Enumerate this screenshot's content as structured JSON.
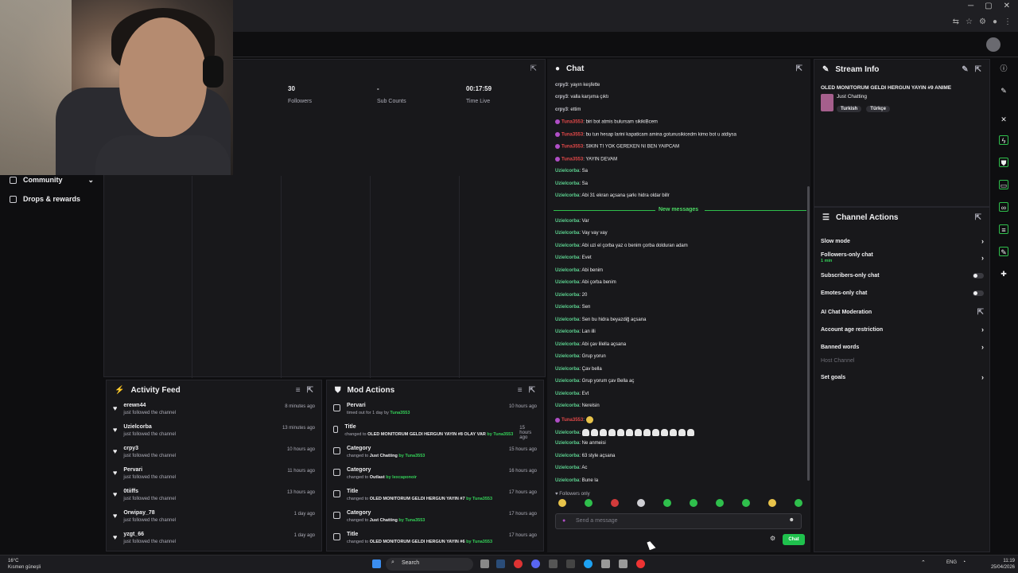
{
  "stats": [
    {
      "value": "30",
      "label": "Followers"
    },
    {
      "value": "-",
      "label": "Sub Counts"
    },
    {
      "value": "00:17:59",
      "label": "Time Live"
    }
  ],
  "nav": {
    "community": "Community",
    "drops": "Drops & rewards"
  },
  "activity": {
    "title": "Activity Feed",
    "items": [
      {
        "name": "erewn44",
        "sub": "just followed the channel",
        "time": "8 minutes ago"
      },
      {
        "name": "Uzielcorba",
        "sub": "just followed the channel",
        "time": "13 minutes ago"
      },
      {
        "name": "crpy3",
        "sub": "just followed the channel",
        "time": "10 hours ago"
      },
      {
        "name": "Pervari",
        "sub": "just followed the channel",
        "time": "11 hours ago"
      },
      {
        "name": "0tiiffs",
        "sub": "just followed the channel",
        "time": "13 hours ago"
      },
      {
        "name": "Orwipay_78",
        "sub": "just followed the channel",
        "time": "1 day ago"
      },
      {
        "name": "yzgt_66",
        "sub": "just followed the channel",
        "time": "1 day ago"
      }
    ]
  },
  "mod": {
    "title": "Mod Actions",
    "items": [
      {
        "title": "Pervari",
        "sub_a": "timed out for 1 day by ",
        "value": "",
        "sub_b": "Tuna3553",
        "time": "10 hours ago"
      },
      {
        "title": "Title",
        "sub_a": "changed to ",
        "value": "OLED MONITORUM GELDI HERGUN YAYIN #8 OLAY VAR",
        "sub_b": "by Tuna3553",
        "time": "15 hours ago"
      },
      {
        "title": "Category",
        "sub_a": "changed to ",
        "value": "Just Chatting",
        "sub_b": "by Tuna3553",
        "time": "15 hours ago"
      },
      {
        "title": "Category",
        "sub_a": "changed to ",
        "value": "Outlast",
        "sub_b": "by lexcaponoir",
        "time": "16 hours ago"
      },
      {
        "title": "Title",
        "sub_a": "changed to ",
        "value": "OLED MONITORUM GELDI HERGUN YAYIN #7",
        "sub_b": "by Tuna3553",
        "time": "17 hours ago"
      },
      {
        "title": "Category",
        "sub_a": "changed to ",
        "value": "Just Chatting",
        "sub_b": "by Tuna3553",
        "time": "17 hours ago"
      },
      {
        "title": "Title",
        "sub_a": "changed to ",
        "value": "OLED MONITORUM GELDI HERGUN YAYIN #6",
        "sub_b": "by Tuna3553",
        "time": "17 hours ago"
      }
    ]
  },
  "chat": {
    "title": "Chat",
    "new_messages": "New messages",
    "followers_only": "Followers only",
    "placeholder": "Send a message",
    "send_label": "Chat",
    "messages": [
      {
        "user": "crpy3",
        "text": ": yayın keşfette",
        "color": "gray",
        "badge": false
      },
      {
        "user": "crpy3",
        "text": ": valla karşıma çıktı",
        "color": "gray",
        "badge": false
      },
      {
        "user": "crpy3",
        "text": ": ettim",
        "color": "gray",
        "badge": false
      },
      {
        "user": "Tuna3553",
        "text": ": biri bot atmis bulursam sikikiBcem",
        "color": "red",
        "badge": true
      },
      {
        "user": "Tuna3553",
        "text": ": bu tun hesap larini kapaticam amina gotunusikicedm kimo bot u atdiysa",
        "color": "red",
        "badge": true
      },
      {
        "user": "Tuna3553",
        "text": ": SIKIN TI YOK GEREKEN NI BEN YAIPCAM",
        "color": "red",
        "badge": true
      },
      {
        "user": "Tuna3553",
        "text": ": YAYIN DEVAM",
        "color": "red",
        "badge": true
      },
      {
        "user": "Uzielcorba",
        "text": ": Sa",
        "color": "green",
        "badge": false
      },
      {
        "user": "Uzielcorba",
        "text": ": Sa",
        "color": "green",
        "badge": false
      },
      {
        "user": "Uzielcorba",
        "text": ": Abi 31 ekran açsana şarkı hidra oldar billr",
        "color": "green",
        "badge": false
      },
      {
        "user": "Uzielcorba",
        "text": ": Var",
        "color": "green",
        "badge": false
      },
      {
        "user": "Uzielcorba",
        "text": ": Vay vay vay",
        "color": "green",
        "badge": false
      },
      {
        "user": "Uzielcorba",
        "text": ": Abi uzi el çorba yaz o benim çorba dolduran adam",
        "color": "green",
        "badge": false
      },
      {
        "user": "Uzielcorba",
        "text": ": Evet",
        "color": "green",
        "badge": false
      },
      {
        "user": "Uzielcorba",
        "text": ": Abi benim",
        "color": "green",
        "badge": false
      },
      {
        "user": "Uzielcorba",
        "text": ": Abi çorba benim",
        "color": "green",
        "badge": false
      },
      {
        "user": "Uzielcorba",
        "text": ": 20",
        "color": "green",
        "badge": false
      },
      {
        "user": "Uzielcorba",
        "text": ": Sen",
        "color": "green",
        "badge": false
      },
      {
        "user": "Uzielcorba",
        "text": ": Sen bu hidra beyazdiğ açsana",
        "color": "green",
        "badge": false
      },
      {
        "user": "Uzielcorba",
        "text": ": Lan illi",
        "color": "green",
        "badge": false
      },
      {
        "user": "Uzielcorba",
        "text": ": Abi çav lilella açsana",
        "color": "green",
        "badge": false
      },
      {
        "user": "Uzielcorba",
        "text": ": Grup yorun",
        "color": "green",
        "badge": false
      },
      {
        "user": "Uzielcorba",
        "text": ": Çav bella",
        "color": "green",
        "badge": false
      },
      {
        "user": "Uzielcorba",
        "text": ": Grup yorum çav Bella aç",
        "color": "green",
        "badge": false
      },
      {
        "user": "Uzielcorba",
        "text": ": Evt",
        "color": "green",
        "badge": false
      },
      {
        "user": "Uzielcorba",
        "text": ": Nerelsin",
        "color": "green",
        "badge": false
      },
      {
        "user": "Tuna3553",
        "text": ":",
        "color": "red",
        "badge": true
      },
      {
        "user": "Uzielcorba",
        "text": ":",
        "color": "green",
        "badge": false
      },
      {
        "user": "Uzielcorba",
        "text": ": Ne anmeisi",
        "color": "green",
        "badge": false
      },
      {
        "user": "Uzielcorba",
        "text": ": 63 style açsana",
        "color": "green",
        "badge": false
      },
      {
        "user": "Uzielcorba",
        "text": ": Ac",
        "color": "green",
        "badge": false
      },
      {
        "user": "Uzielcorba",
        "text": ": Bune la",
        "color": "green",
        "badge": false
      }
    ]
  },
  "info": {
    "title": "Stream Info",
    "stream_title": "OLED MONITORUM GELDI HERGUN YAYIN #9 ANIME",
    "category": "Just Chatting",
    "tags": [
      "Turkish",
      "Türkçe"
    ]
  },
  "actions": {
    "title": "Channel Actions",
    "slow": "Slow mode",
    "followers": "Followers-only chat",
    "followers_sub": "1 min",
    "subs": "Subscribers-only chat",
    "emotes": "Emotes-only chat",
    "ai": "AI Chat Moderation",
    "age": "Account age restriction",
    "banned": "Banned words",
    "host": "Host Channel",
    "goals": "Set goals"
  },
  "taskbar": {
    "search": "Search",
    "weather_temp": "16°C",
    "weather_desc": "Kısmen güneşli",
    "lang": "ENG",
    "time": "11:19",
    "date": "25/04/2026"
  },
  "colors": {
    "accent": "#1fc14d",
    "chat_green": "#5cd18f",
    "mod_red": "#e04848",
    "panel": "#18181b"
  }
}
